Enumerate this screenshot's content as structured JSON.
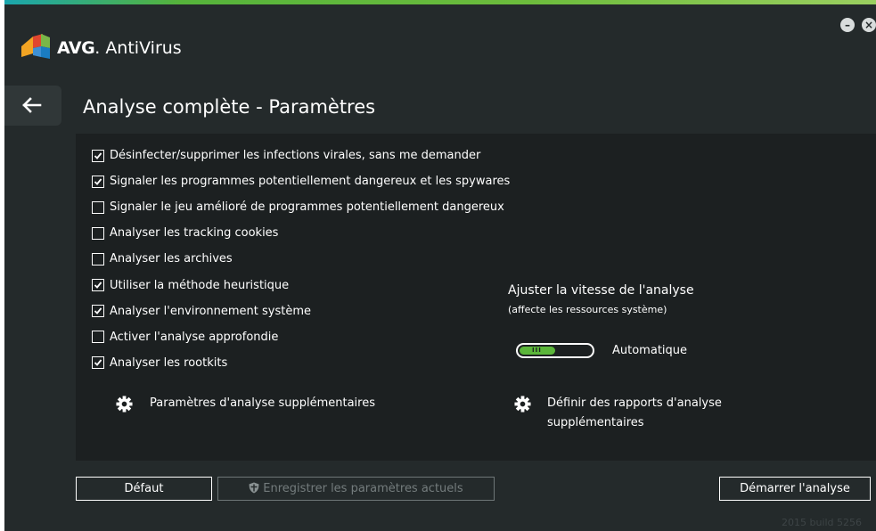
{
  "window": {
    "app_name_brand": "AVG",
    "app_name_product": "AntiVirus",
    "minimize_glyph": "–",
    "close_glyph": "×",
    "build": "2015  build 5256"
  },
  "page": {
    "title": "Analyse complète - Paramètres"
  },
  "options": [
    {
      "label": "Désinfecter/supprimer les infections virales, sans me demander",
      "checked": true
    },
    {
      "label": "Signaler les programmes potentiellement dangereux et les spywares",
      "checked": true
    },
    {
      "label": "Signaler le jeu amélioré de programmes potentiellement dangereux",
      "checked": false
    },
    {
      "label": "Analyser les tracking cookies",
      "checked": false
    },
    {
      "label": "Analyser les archives",
      "checked": false
    },
    {
      "label": "Utiliser la méthode heuristique",
      "checked": true
    },
    {
      "label": "Analyser l'environnement système",
      "checked": true
    },
    {
      "label": "Activer l'analyse approfondie",
      "checked": false
    },
    {
      "label": "Analyser les rootkits",
      "checked": true
    }
  ],
  "speed": {
    "title": "Ajuster la vitesse de l'analyse",
    "subtitle": "(affecte les ressources système)",
    "value_label": "Automatique",
    "level": 0.5
  },
  "links": {
    "additional_settings": "Paramètres d'analyse supplémentaires",
    "additional_reports": "Définir des rapports d'analyse supplémentaires"
  },
  "buttons": {
    "default": "Défaut",
    "save_current": "Enregistrer les paramètres actuels",
    "start_scan": "Démarrer l'analyse"
  },
  "icons": {
    "back": "back-arrow-icon",
    "gear": "gear-icon",
    "shield": "shield-icon",
    "check": "check-icon"
  },
  "colors": {
    "background": "#242a2b",
    "panel": "#1c2021",
    "accent_green": "#5bb63a",
    "text": "#ffffff",
    "disabled_text": "#747c7d"
  }
}
